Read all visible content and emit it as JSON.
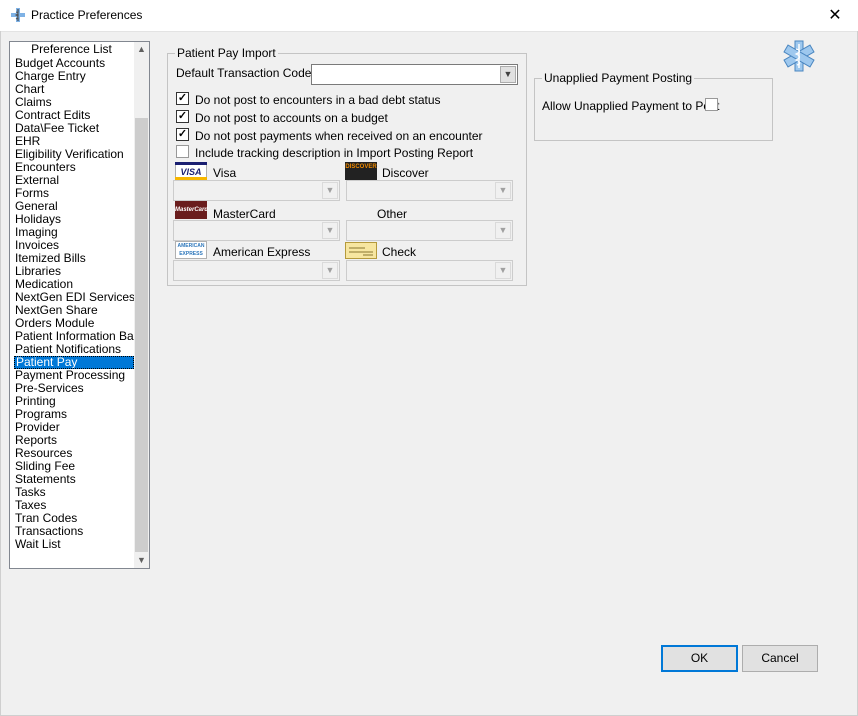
{
  "window": {
    "title": "Practice Preferences"
  },
  "preference_list": {
    "header": "Preference List",
    "selected_index": 24,
    "items": [
      "Budget Accounts",
      "Charge Entry",
      "Chart",
      "Claims",
      "Contract Edits",
      "Data\\Fee Ticket",
      "EHR",
      "Eligibility Verification",
      "Encounters",
      "External",
      "Forms",
      "General",
      "Holidays",
      "Imaging",
      "Invoices",
      "Itemized Bills",
      "Libraries",
      "Medication",
      "NextGen EDI Services",
      "NextGen Share",
      "Orders Module",
      "Patient Information Bar",
      "Patient Notifications",
      "Patient Pay",
      "Payment Processing",
      "Pre-Services",
      "Printing",
      "Programs",
      "Provider",
      "Reports",
      "Resources",
      "Sliding Fee",
      "Statements",
      "Tasks",
      "Taxes",
      "Tran Codes",
      "Transactions",
      "Wait List"
    ]
  },
  "patient_pay_import": {
    "legend": "Patient Pay Import",
    "default_transaction_code_label": "Default Transaction Code:",
    "default_transaction_code_value": "",
    "options": [
      {
        "label": "Do not post to encounters in a bad debt status",
        "checked": true
      },
      {
        "label": "Do not post to accounts on a budget",
        "checked": true
      },
      {
        "label": "Do not post payments when received on an encounter",
        "checked": true
      },
      {
        "label": "Include tracking description in Import Posting Report",
        "checked": false
      }
    ],
    "payment_types": {
      "visa": {
        "label": "Visa",
        "icon": "visa-card-icon",
        "icon_text": "VISA",
        "value": ""
      },
      "discover": {
        "label": "Discover",
        "icon": "discover-card-icon",
        "icon_text": "DISCOVER",
        "value": ""
      },
      "mastercard": {
        "label": "MasterCard",
        "icon": "mastercard-icon",
        "icon_text": "MasterCard",
        "value": ""
      },
      "other": {
        "label": "Other",
        "value": ""
      },
      "amex": {
        "label": "American Express",
        "icon": "amex-card-icon",
        "icon_text": "AMERICAN EXPRESS",
        "value": ""
      },
      "check": {
        "label": "Check",
        "icon": "check-icon",
        "value": ""
      }
    }
  },
  "unapplied_payment_posting": {
    "legend": "Unapplied Payment Posting",
    "allow_label": "Allow Unapplied Payment to Post",
    "allow_checked": false
  },
  "buttons": {
    "ok": "OK",
    "cancel": "Cancel"
  },
  "colors": {
    "selection": "#0078d7",
    "background": "#f0f0f0"
  }
}
